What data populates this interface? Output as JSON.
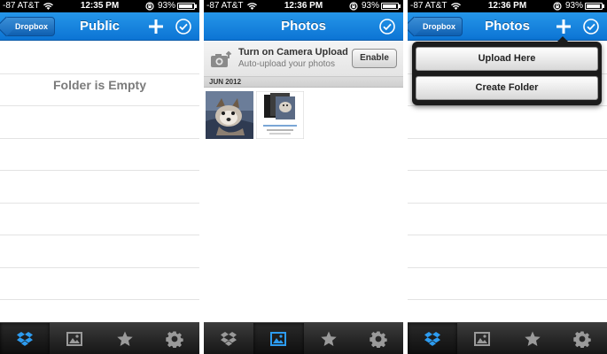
{
  "colors": {
    "accent": "#1585e0",
    "tabbar": "#1f1f1f",
    "active_tab_icon": "#2d9cf0"
  },
  "status_bar": {
    "carrier": "-87 AT&T",
    "battery": "93%",
    "battery_level": 0.93
  },
  "panels": [
    {
      "time": "12:35 PM",
      "nav": {
        "back": "Dropbox",
        "title": "Public"
      },
      "empty_message": "Folder is Empty",
      "active_tab": "dropbox"
    },
    {
      "time": "12:36 PM",
      "nav": {
        "title": "Photos"
      },
      "camera_upload": {
        "title": "Turn on Camera Upload",
        "subtitle": "Auto-upload your photos",
        "button": "Enable"
      },
      "section": "JUN 2012",
      "thumbnails": [
        "photo of a small dog on a blanket",
        "screenshot of a photo collage"
      ],
      "active_tab": "photos"
    },
    {
      "time": "12:36 PM",
      "nav": {
        "back": "Dropbox",
        "title": "Photos"
      },
      "menu": {
        "items": [
          "Upload Here",
          "Create Folder"
        ]
      },
      "active_tab": "dropbox"
    }
  ],
  "tabs": [
    {
      "id": "dropbox",
      "icon": "dropbox-icon"
    },
    {
      "id": "photos",
      "icon": "photos-icon"
    },
    {
      "id": "favorites",
      "icon": "star-icon"
    },
    {
      "id": "settings",
      "icon": "gear-icon"
    }
  ]
}
